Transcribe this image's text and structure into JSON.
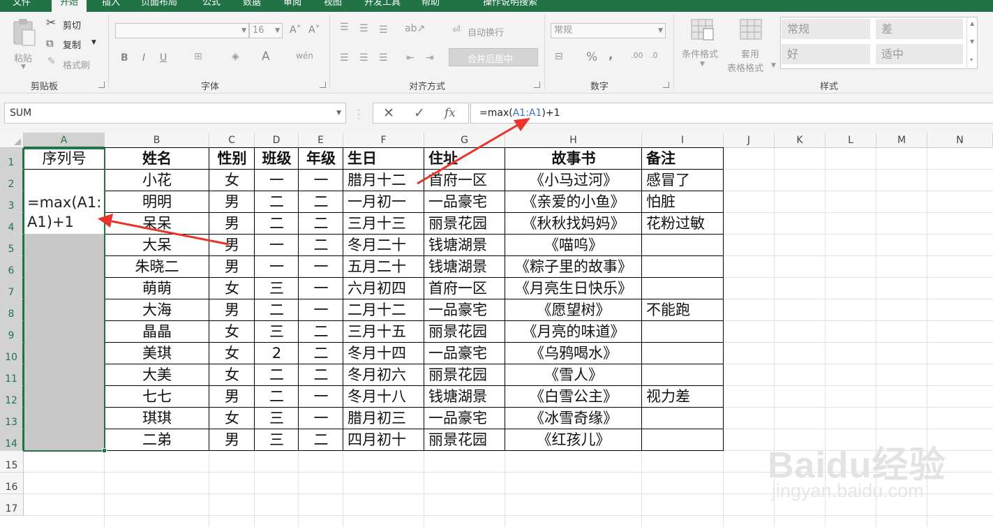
{
  "ribbon": {
    "tabs": [
      "文件",
      "开始",
      "插入",
      "页面布局",
      "公式",
      "数据",
      "审阅",
      "视图",
      "开发工具",
      "帮助",
      "操作说明搜索"
    ],
    "clipboard": {
      "paste": "粘贴",
      "cut": "剪切",
      "copy": "复制",
      "format_painter": "格式刷",
      "label": "剪贴板"
    },
    "font": {
      "size": "16",
      "bold": "B",
      "italic": "I",
      "underline": "U",
      "label": "字体",
      "font_color": "A"
    },
    "alignment": {
      "wrap": "自动换行",
      "merge": "合并后居中",
      "label": "对齐方式"
    },
    "number": {
      "format": "常规",
      "percent": "%",
      "comma": ",",
      "label": "数字"
    },
    "styles": {
      "conditional": "条件格式",
      "table_format_1": "套用",
      "table_format_2": "表格格式",
      "cells": [
        "常规",
        "差",
        "好",
        "适中"
      ],
      "label": "样式"
    }
  },
  "formula_bar": {
    "name_box": "SUM",
    "formula_prefix": "=max(",
    "formula_ref": "A1:A1",
    "formula_suffix": ")+1",
    "cancel": "✕",
    "enter": "✓",
    "fx": "fx"
  },
  "grid": {
    "columns": [
      "A",
      "B",
      "C",
      "D",
      "E",
      "F",
      "G",
      "H",
      "I",
      "J",
      "K",
      "L",
      "M",
      "N"
    ],
    "rows": [
      "1",
      "2",
      "3",
      "4",
      "5",
      "6",
      "7",
      "8",
      "9",
      "10",
      "11",
      "12",
      "13",
      "14",
      "15",
      "16",
      "17"
    ],
    "selected_column": "A",
    "editing_cell_text_1": "=max(A1:",
    "editing_cell_text_2": "A1)+1",
    "header": [
      "序列号",
      "姓名",
      "性别",
      "班级",
      "年级",
      "生日",
      "住址",
      "故事书",
      "备注"
    ],
    "data": [
      [
        "小花",
        "女",
        "一",
        "一",
        "腊月十二",
        "首府一区",
        "《小马过河》",
        "感冒了"
      ],
      [
        "明明",
        "男",
        "二",
        "二",
        "一月初一",
        "一品豪宅",
        "《亲爱的小鱼》",
        "怕脏"
      ],
      [
        "呆呆",
        "男",
        "二",
        "二",
        "三月十三",
        "丽景花园",
        "《秋秋找妈妈》",
        "花粉过敏"
      ],
      [
        "大呆",
        "男",
        "一",
        "二",
        "冬月二十",
        "钱塘湖景",
        "《喵呜》",
        ""
      ],
      [
        "朱晓二",
        "男",
        "一",
        "一",
        "五月二十",
        "钱塘湖景",
        "《粽子里的故事》",
        ""
      ],
      [
        "萌萌",
        "女",
        "三",
        "一",
        "六月初四",
        "首府一区",
        "《月亮生日快乐》",
        ""
      ],
      [
        "大海",
        "男",
        "二",
        "一",
        "二月十二",
        "一品豪宅",
        "《愿望树》",
        "不能跑"
      ],
      [
        "晶晶",
        "女",
        "三",
        "二",
        "三月十五",
        "丽景花园",
        "《月亮的味道》",
        ""
      ],
      [
        "美琪",
        "女",
        "2",
        "二",
        "冬月十四",
        "一品豪宅",
        "《乌鸦喝水》",
        ""
      ],
      [
        "大美",
        "女",
        "二",
        "二",
        "冬月初六",
        "丽景花园",
        "《雪人》",
        ""
      ],
      [
        "七七",
        "男",
        "二",
        "一",
        "冬月十八",
        "钱塘湖景",
        "《白雪公主》",
        "视力差"
      ],
      [
        "琪琪",
        "女",
        "三",
        "一",
        "腊月初三",
        "一品豪宅",
        "《冰雪奇缘》",
        ""
      ],
      [
        "二弟",
        "男",
        "三",
        "二",
        "四月初十",
        "丽景花园",
        "《红孩儿》",
        ""
      ]
    ]
  },
  "annotation": {
    "arrow_color": "#e8342c"
  },
  "watermark": {
    "logo": "Baidu经验",
    "url": "jingyan.baidu.com"
  },
  "theme": {
    "excel_green": "#217346",
    "ref_blue": "#3a6fc4"
  }
}
